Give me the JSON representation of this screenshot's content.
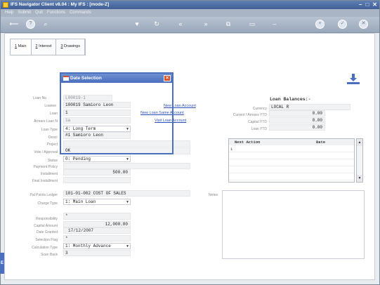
{
  "window": {
    "title": "IFS Navigator Client v8.04 : My IFS : [mode-Z]"
  },
  "menu": [
    "Help",
    "Submit",
    "Quit",
    "Functions",
    "Commands"
  ],
  "tabs": [
    {
      "key": "1",
      "label": "Main"
    },
    {
      "key": "2",
      "label": "Interest"
    },
    {
      "key": "3",
      "label": "Drawings"
    }
  ],
  "dialog": {
    "title": "Date Selection"
  },
  "left_form": {
    "loan_no": {
      "label": "Loan No",
      "value": "L00019-1"
    },
    "loanee": {
      "label": "Loanee",
      "value": "100019 Samioro Leon"
    },
    "loan_name": {
      "label": "Loan",
      "value": "1"
    },
    "arrears_loan": {
      "label": "Arrears Loan N",
      "value": "1a"
    },
    "loan_type": {
      "label": "Loan Type",
      "value": "4: Long Term"
    },
    "descr": {
      "label": "Descr",
      "value": "#1 Samioro Leon"
    },
    "project": {
      "label": "Project",
      "value": ""
    },
    "vote_approval": {
      "label": "Vote / Approval",
      "value": "OK"
    },
    "status": {
      "label": "Status",
      "value": "0: Pending"
    },
    "payment_policy": {
      "label": "Payment Policy",
      "value": ""
    },
    "installment": {
      "label": "Installment",
      "value": "500.00"
    },
    "final_installment": {
      "label": "Final Installment",
      "value": ""
    },
    "pal_points_ledger": {
      "label": "Pal Points Ledger",
      "value": "101-01-002 COST OF SALES"
    },
    "charge_type": {
      "label": "Charge Type",
      "value": "1: Main Loan"
    },
    "responsibility": {
      "label": "Responsibility",
      "value": "*"
    },
    "capital_amount": {
      "label": "Capital Amount",
      "value": "12,000.00"
    },
    "date_granted": {
      "label": "Date Granted",
      "value": "17/12/2007"
    },
    "selection_flag": {
      "label": "Selection Flag",
      "value": "*"
    },
    "calculation_type": {
      "label": "Calculation Type",
      "value": "1: Monthly Advance"
    },
    "scan_back": {
      "label": "Scan Back",
      "value": "3"
    }
  },
  "links": {
    "new_loan_account": "New Loan Account",
    "new_loan_same_account": "New Loan Same Account",
    "visit_loan_account": "Visit Loan Account"
  },
  "balances": {
    "heading": "Loan Balances:-",
    "currency": {
      "label": "Currency",
      "value": "LOCAL R"
    },
    "current_arrears_ytd": {
      "label": "Current / Arrears YTD",
      "value": "0.00"
    },
    "capital_ytd": {
      "label": "Capital YTD",
      "value": "0.00"
    },
    "loan_ytd": {
      "label": "Loan YTD",
      "value": "0.00"
    }
  },
  "actions_grid": {
    "columns": [
      "Next Action",
      "Date"
    ],
    "rows": [
      [
        "1",
        ""
      ]
    ]
  },
  "notes": {
    "label": "Notes"
  }
}
